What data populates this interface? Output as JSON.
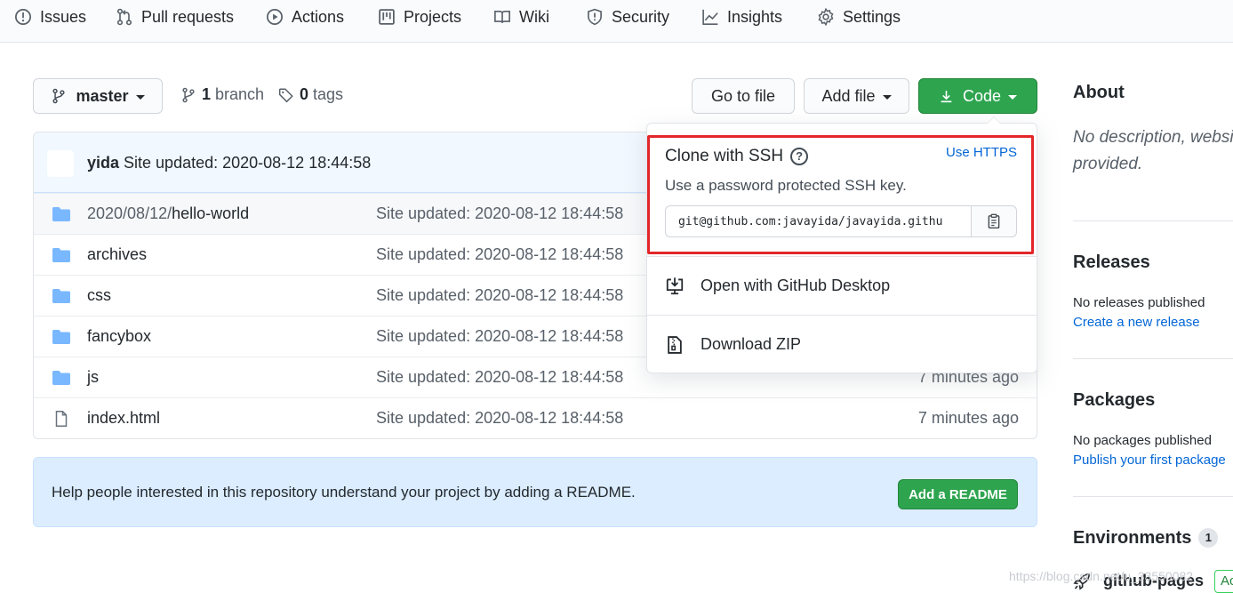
{
  "nav": {
    "tabs": [
      {
        "label": "Issues",
        "icon": "issue-icon"
      },
      {
        "label": "Pull requests",
        "icon": "pull-request-icon"
      },
      {
        "label": "Actions",
        "icon": "play-icon"
      },
      {
        "label": "Projects",
        "icon": "project-icon"
      },
      {
        "label": "Wiki",
        "icon": "book-icon"
      },
      {
        "label": "Security",
        "icon": "shield-icon"
      },
      {
        "label": "Insights",
        "icon": "graph-icon"
      },
      {
        "label": "Settings",
        "icon": "gear-icon"
      }
    ]
  },
  "branch": {
    "current": "master",
    "branch_count": "1",
    "branch_label": "branch",
    "tag_count": "0",
    "tag_label": "tags"
  },
  "toolbar": {
    "go_to_file": "Go to file",
    "add_file": "Add file",
    "code": "Code"
  },
  "commit": {
    "author": "yida",
    "message": "Site updated: 2020-08-12 18:44:58"
  },
  "files": [
    {
      "type": "folder",
      "prefix": "2020/08/12/",
      "name": "hello-world",
      "message": "Site updated: 2020-08-12 18:44:58",
      "age": ""
    },
    {
      "type": "folder",
      "prefix": "",
      "name": "archives",
      "message": "Site updated: 2020-08-12 18:44:58",
      "age": ""
    },
    {
      "type": "folder",
      "prefix": "",
      "name": "css",
      "message": "Site updated: 2020-08-12 18:44:58",
      "age": ""
    },
    {
      "type": "folder",
      "prefix": "",
      "name": "fancybox",
      "message": "Site updated: 2020-08-12 18:44:58",
      "age": ""
    },
    {
      "type": "folder",
      "prefix": "",
      "name": "js",
      "message": "Site updated: 2020-08-12 18:44:58",
      "age": "7 minutes ago"
    },
    {
      "type": "file",
      "prefix": "",
      "name": "index.html",
      "message": "Site updated: 2020-08-12 18:44:58",
      "age": "7 minutes ago"
    }
  ],
  "readme": {
    "text": "Help people interested in this repository understand your project by adding a README.",
    "button": "Add a README"
  },
  "clone": {
    "title": "Clone with SSH",
    "help": "?",
    "use_https": "Use HTTPS",
    "subtitle": "Use a password protected SSH key.",
    "url": "git@github.com:javayida/javayida.githu",
    "open_desktop": "Open with GitHub Desktop",
    "download_zip": "Download ZIP"
  },
  "sidebar": {
    "about_title": "About",
    "description": "No description, website provided.",
    "releases_title": "Releases",
    "releases_text": "No releases published",
    "releases_link": "Create a new release",
    "packages_title": "Packages",
    "packages_text": "No packages published",
    "packages_link": "Publish your first package",
    "environments_title": "Environments",
    "environments_count": "1",
    "env_name": "github-pages",
    "env_badge": "Ac"
  },
  "watermark": "https://blog.csdn.net/u_33550082",
  "colors": {
    "primary_green": "#2ea44f",
    "link_blue": "#0366d6",
    "folder_blue": "#79b8ff",
    "highlight_red": "#e3262a"
  }
}
